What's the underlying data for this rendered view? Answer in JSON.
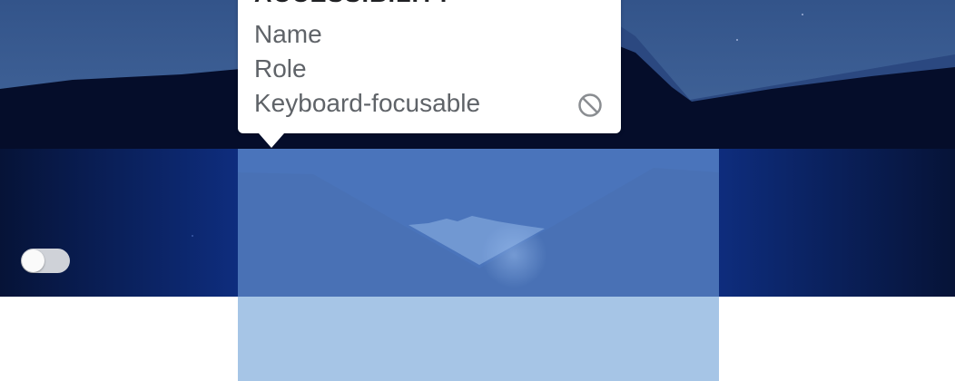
{
  "tooltip": {
    "heading": "ACCESSIBILITY",
    "rows": [
      {
        "label": "Name"
      },
      {
        "label": "Role"
      },
      {
        "label": "Keyboard-focusable",
        "status_icon": "blocked-icon"
      }
    ]
  },
  "toggle": {
    "state": "off"
  },
  "colors": {
    "sky": "#3d5e93",
    "mountains": "#050d2a",
    "water": "#0e2d7e",
    "highlight": "#6fa0e1",
    "highlight_overflow": "#a6c5e6",
    "tooltip_bg": "#ffffff"
  }
}
